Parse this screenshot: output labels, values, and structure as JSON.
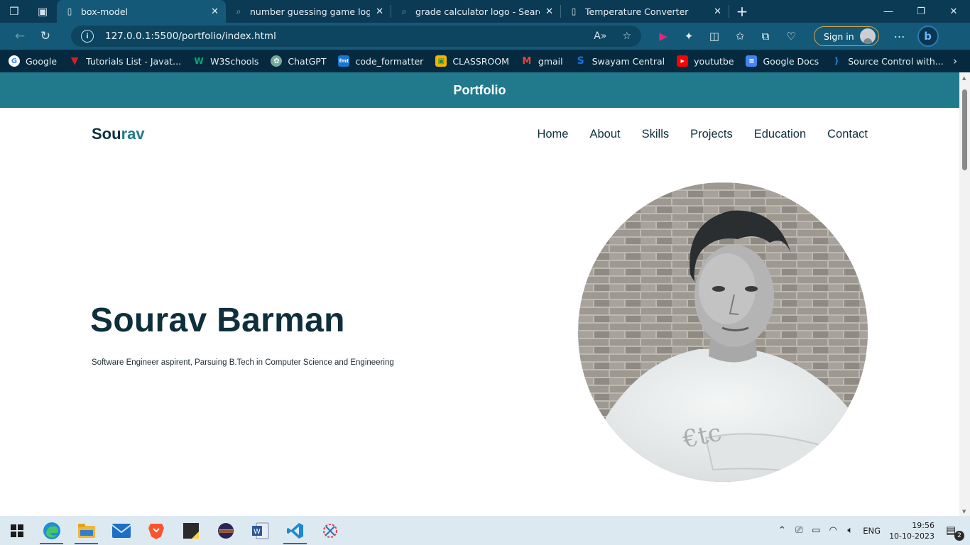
{
  "browser": {
    "tabs": [
      {
        "title": "box-model",
        "icon": "page-icon",
        "active": true
      },
      {
        "title": "number guessing game logo - Se",
        "icon": "search-icon",
        "active": false
      },
      {
        "title": "grade calculator logo - Search",
        "icon": "search-icon",
        "active": false
      },
      {
        "title": "Temperature Converter",
        "icon": "page-icon",
        "active": false
      }
    ],
    "new_tab": "+",
    "url": "127.0.0.1:5500/portfolio/index.html",
    "sign_in_label": "Sign in",
    "bookmarks": [
      {
        "label": "Google",
        "icon": "google-icon",
        "color": "#ffffff"
      },
      {
        "label": "Tutorials List - Javat...",
        "icon": "javatpoint-icon",
        "color": "#d81e24"
      },
      {
        "label": "W3Schools",
        "icon": "w3schools-icon",
        "color": "#04aa6d"
      },
      {
        "label": "ChatGPT",
        "icon": "chatgpt-icon",
        "color": "#74aa9c"
      },
      {
        "label": "code_formatter",
        "icon": "fmt-icon",
        "color": "#1976d2"
      },
      {
        "label": "CLASSROOM",
        "icon": "classroom-icon",
        "color": "#f4b400"
      },
      {
        "label": "gmail",
        "icon": "gmail-icon",
        "color": "#ea4335"
      },
      {
        "label": "Swayam Central",
        "icon": "swayam-icon",
        "color": "#1a73e8"
      },
      {
        "label": "yoututbe",
        "icon": "youtube-icon",
        "color": "#ff0000"
      },
      {
        "label": "Google Docs",
        "icon": "docs-icon",
        "color": "#4285f4"
      },
      {
        "label": "Source Control with...",
        "icon": "vscode-icon",
        "color": "#2f8fe0"
      }
    ]
  },
  "page": {
    "banner_title": "Portfolio",
    "logo_part1": "Sou",
    "logo_part2": "rav",
    "nav": [
      "Home",
      "About",
      "Skills",
      "Projects",
      "Education",
      "Contact"
    ],
    "hero_name": "Sourav Barman",
    "hero_subtitle": "Software Engineer aspirent, Parsuing B.Tech in Computer Science and Engineering",
    "accent_color": "#217a8c",
    "text_color": "#0f2f3d"
  },
  "taskbar": {
    "apps": [
      "edge-icon",
      "file-explorer-icon",
      "mail-icon",
      "brave-icon",
      "sticky-notes-icon",
      "eclipse-icon",
      "word-icon",
      "vscode-icon",
      "snipping-tool-icon"
    ],
    "language": "ENG",
    "time": "19:56",
    "date": "10-10-2023",
    "notification_count": "2"
  }
}
